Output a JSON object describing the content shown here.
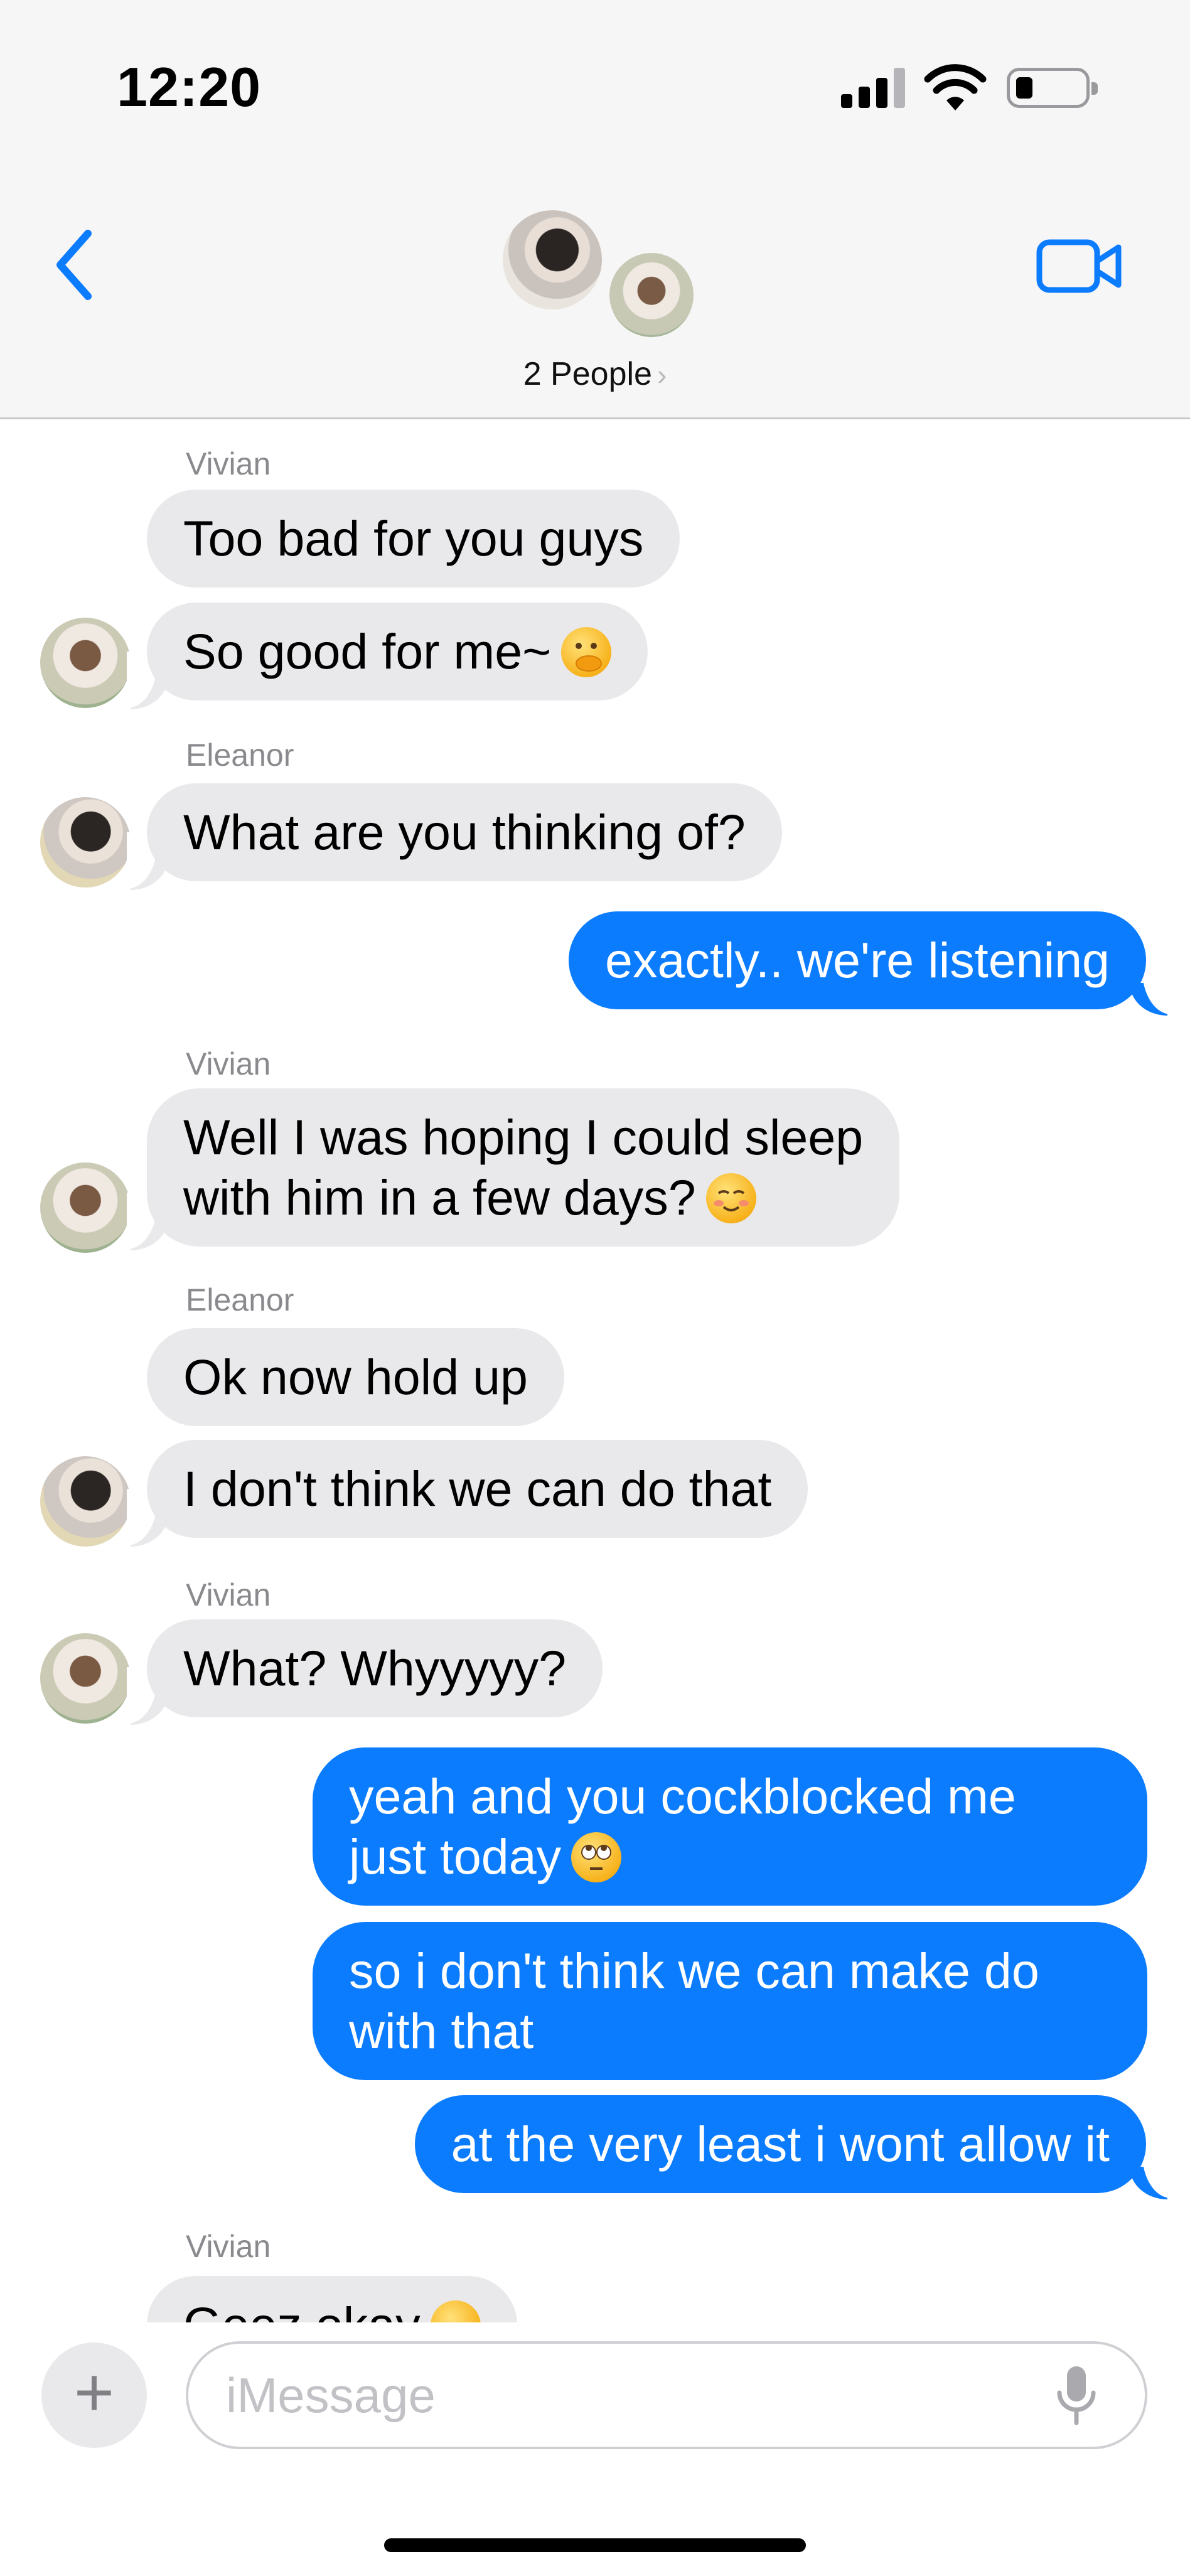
{
  "status_bar": {
    "time": "12:20"
  },
  "header": {
    "title": "2 People"
  },
  "messages": [
    {
      "sender": "Vivian",
      "text": "Too bad for you guys"
    },
    {
      "text": "So good for me~"
    },
    {
      "sender": "Eleanor",
      "text": "What are you thinking of?"
    },
    {
      "text": "exactly.. we're listening"
    },
    {
      "sender": "Vivian",
      "text": "Well I was hoping I could sleep\nwith him in a few days?"
    },
    {
      "sender": "Eleanor",
      "text": "Ok now hold up"
    },
    {
      "text": "I don't think we can do that"
    },
    {
      "sender": "Vivian",
      "text": "What? Whyyyyy?"
    },
    {
      "text": "yeah and you cockblocked me\njust today"
    },
    {
      "text": "so i don't think we can make do\nwith that"
    },
    {
      "text": "at the very least i wont allow it"
    },
    {
      "sender": "Vivian",
      "text": "Geez okay"
    }
  ],
  "composer": {
    "placeholder": "iMessage",
    "value": ""
  },
  "colors": {
    "outgoing": "#0b7cfe",
    "incoming": "#e9e9eb",
    "accent": "#0b7cfe"
  }
}
